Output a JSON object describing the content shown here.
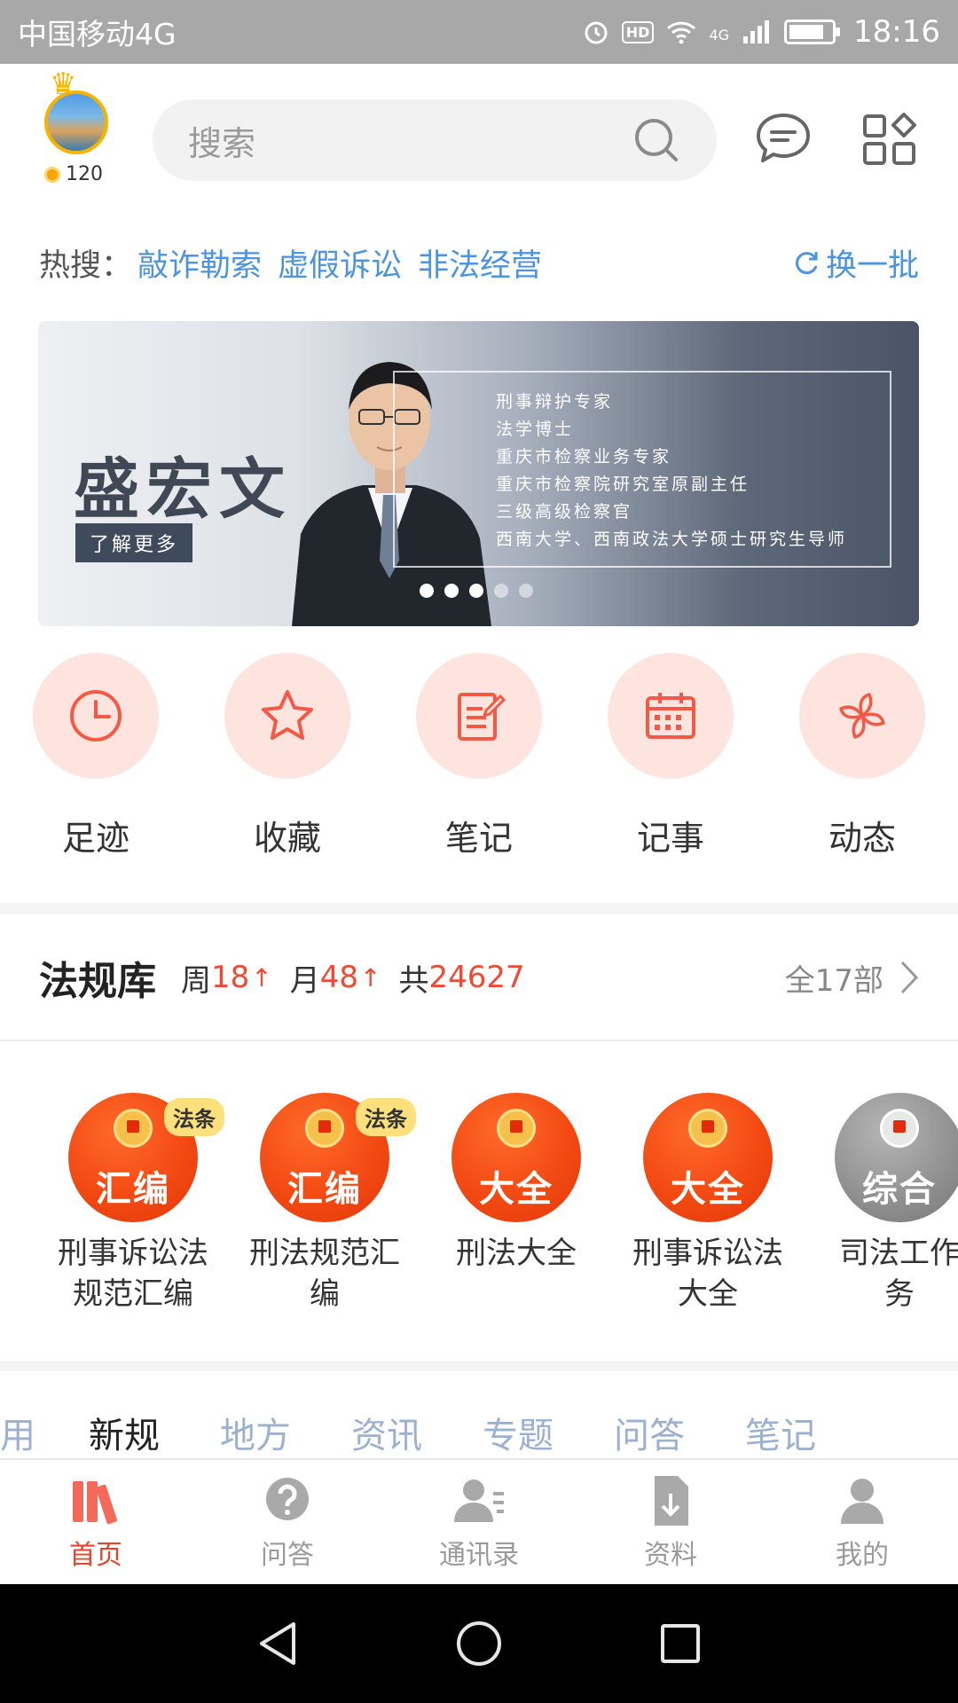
{
  "status_bar": {
    "carrier": "中国移动4G",
    "hd": "HD",
    "net": "4G",
    "time": "18:16"
  },
  "header": {
    "coins": "120",
    "search_placeholder": "搜索"
  },
  "hot_search": {
    "label": "热搜：",
    "keywords": [
      "敲诈勒索",
      "虚假诉讼",
      "非法经营"
    ],
    "refresh": "换一批"
  },
  "banner": {
    "name": "盛宏文",
    "more": "了解更多",
    "titles": [
      "刑事辩护专家",
      "法学博士",
      "重庆市检察业务专家",
      "重庆市检察院研究室原副主任",
      "三级高级检察官",
      "西南大学、西南政法大学硕士研究生导师"
    ],
    "slides": 5,
    "active_slide": 3
  },
  "quick_nav": [
    {
      "label": "足迹",
      "icon": "clock-icon"
    },
    {
      "label": "收藏",
      "icon": "star-icon"
    },
    {
      "label": "笔记",
      "icon": "note-icon"
    },
    {
      "label": "记事",
      "icon": "calendar-icon"
    },
    {
      "label": "动态",
      "icon": "pinwheel-icon"
    }
  ],
  "law_library": {
    "title": "法规库",
    "week_label": "周",
    "week_count": "18",
    "month_label": "月",
    "month_count": "48",
    "total_label": "共",
    "total_count": "24627",
    "all_label": "全17部"
  },
  "books": [
    {
      "cover": "汇编",
      "tag": "法条",
      "label_1": "刑事诉讼法",
      "label_2": "规范汇编"
    },
    {
      "cover": "汇编",
      "tag": "法条",
      "label_1": "刑法规范汇",
      "label_2": "编"
    },
    {
      "cover": "大全",
      "tag": "",
      "label_1": "刑法大全",
      "label_2": ""
    },
    {
      "cover": "大全",
      "tag": "",
      "label_1": "刑事诉讼法",
      "label_2": "大全"
    },
    {
      "cover": "综合",
      "tag": "",
      "label_1": "司法工作",
      "label_2": "务"
    }
  ],
  "tabs": [
    "用",
    "新规",
    "地方",
    "资讯",
    "专题",
    "问答",
    "笔记"
  ],
  "bottom_nav": [
    {
      "label": "首页",
      "icon": "books-icon",
      "active": true
    },
    {
      "label": "问答",
      "icon": "question-icon",
      "active": false
    },
    {
      "label": "通讯录",
      "icon": "contacts-icon",
      "active": false
    },
    {
      "label": "资料",
      "icon": "download-file-icon",
      "active": false
    },
    {
      "label": "我的",
      "icon": "user-icon",
      "active": false
    }
  ],
  "colors": {
    "accent": "#f04b32",
    "link": "#4c93e0",
    "icon_bg": "#fde4df"
  }
}
